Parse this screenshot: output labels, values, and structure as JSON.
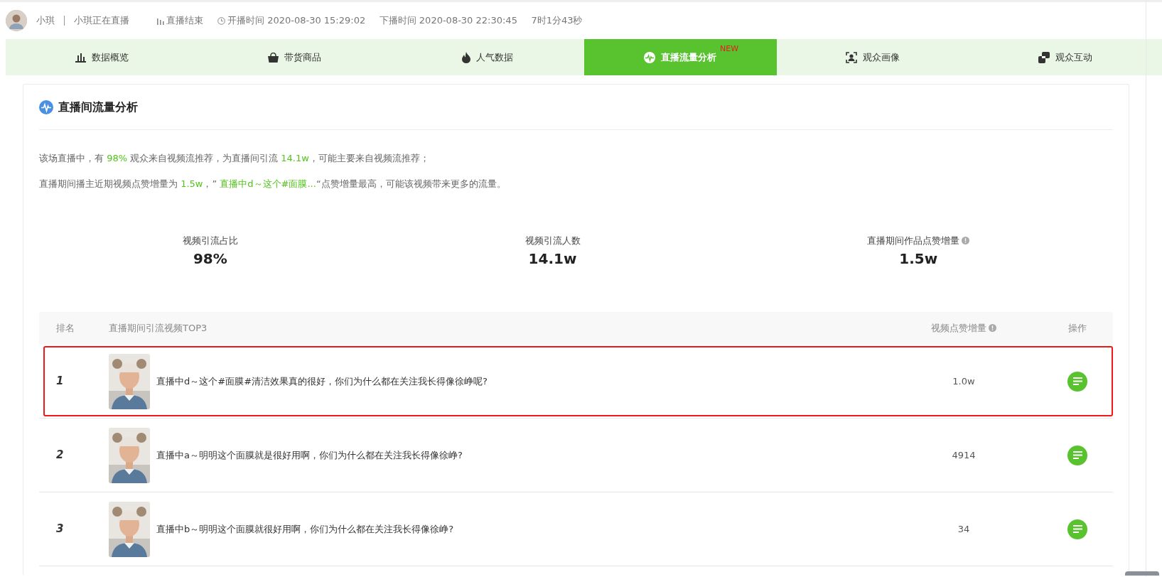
{
  "header": {
    "name": "小琪",
    "status": "小琪正在直播",
    "live_state": "直播结束",
    "start": "开播时间 2020-08-30 15:29:02",
    "end": "下播时间 2020-08-30 22:30:45",
    "duration": "7时1分43秒"
  },
  "tabs": [
    {
      "label": "数据概览",
      "selected": false
    },
    {
      "label": "带货商品",
      "selected": false
    },
    {
      "label": "人气数据",
      "selected": false
    },
    {
      "label": "直播流量分析",
      "selected": true,
      "badge": "NEW"
    },
    {
      "label": "观众画像",
      "selected": false
    },
    {
      "label": "观众互动",
      "selected": false
    }
  ],
  "section": {
    "title": "直播间流量分析",
    "summary": [
      [
        {
          "text": "该场直播中，有 ",
          "highlight": false
        },
        {
          "text": "98%",
          "highlight": true
        },
        {
          "text": " 观众来自视频流推荐，为直播间引流 ",
          "highlight": false
        },
        {
          "text": "14.1w",
          "highlight": true
        },
        {
          "text": "，可能主要来自视频流推荐；",
          "highlight": false
        }
      ],
      [
        {
          "text": "直播期间播主近期视频点赞增量为 ",
          "highlight": false
        },
        {
          "text": "1.5w",
          "highlight": true
        },
        {
          "text": "，” ",
          "highlight": false
        },
        {
          "text": "直播中d～这个#面膜...",
          "highlight": true
        },
        {
          "text": "“点赞增量最高，可能该视频带来更多的流量。",
          "highlight": false
        }
      ]
    ],
    "stats": [
      {
        "label": "视频引流占比",
        "value": "98%",
        "info": false
      },
      {
        "label": "视频引流人数",
        "value": "14.1w",
        "info": false
      },
      {
        "label": "直播期间作品点赞增量",
        "value": "1.5w",
        "info": true
      }
    ]
  },
  "table": {
    "columns": [
      {
        "label": "排名",
        "info": false
      },
      {
        "label": "直播期间引流视频TOP3",
        "info": false
      },
      {
        "label": "视频点赞增量",
        "info": true
      },
      {
        "label": "操作",
        "info": false
      }
    ],
    "rows": [
      {
        "rank": "1",
        "title": "直播中d～这个#面膜#清洁效果真的很好，你们为什么都在关注我长得像徐峥呢?",
        "likes": "1.0w",
        "highlighted": true
      },
      {
        "rank": "2",
        "title": "直播中a～明明这个面膜就是很好用啊，你们为什么都在关注我长得像徐峥?",
        "likes": "4914",
        "highlighted": false
      },
      {
        "rank": "3",
        "title": "直播中b～明明这个面膜就很好用啊，你们为什么都在关注我长得像徐峥?",
        "likes": "34",
        "highlighted": false
      }
    ]
  }
}
